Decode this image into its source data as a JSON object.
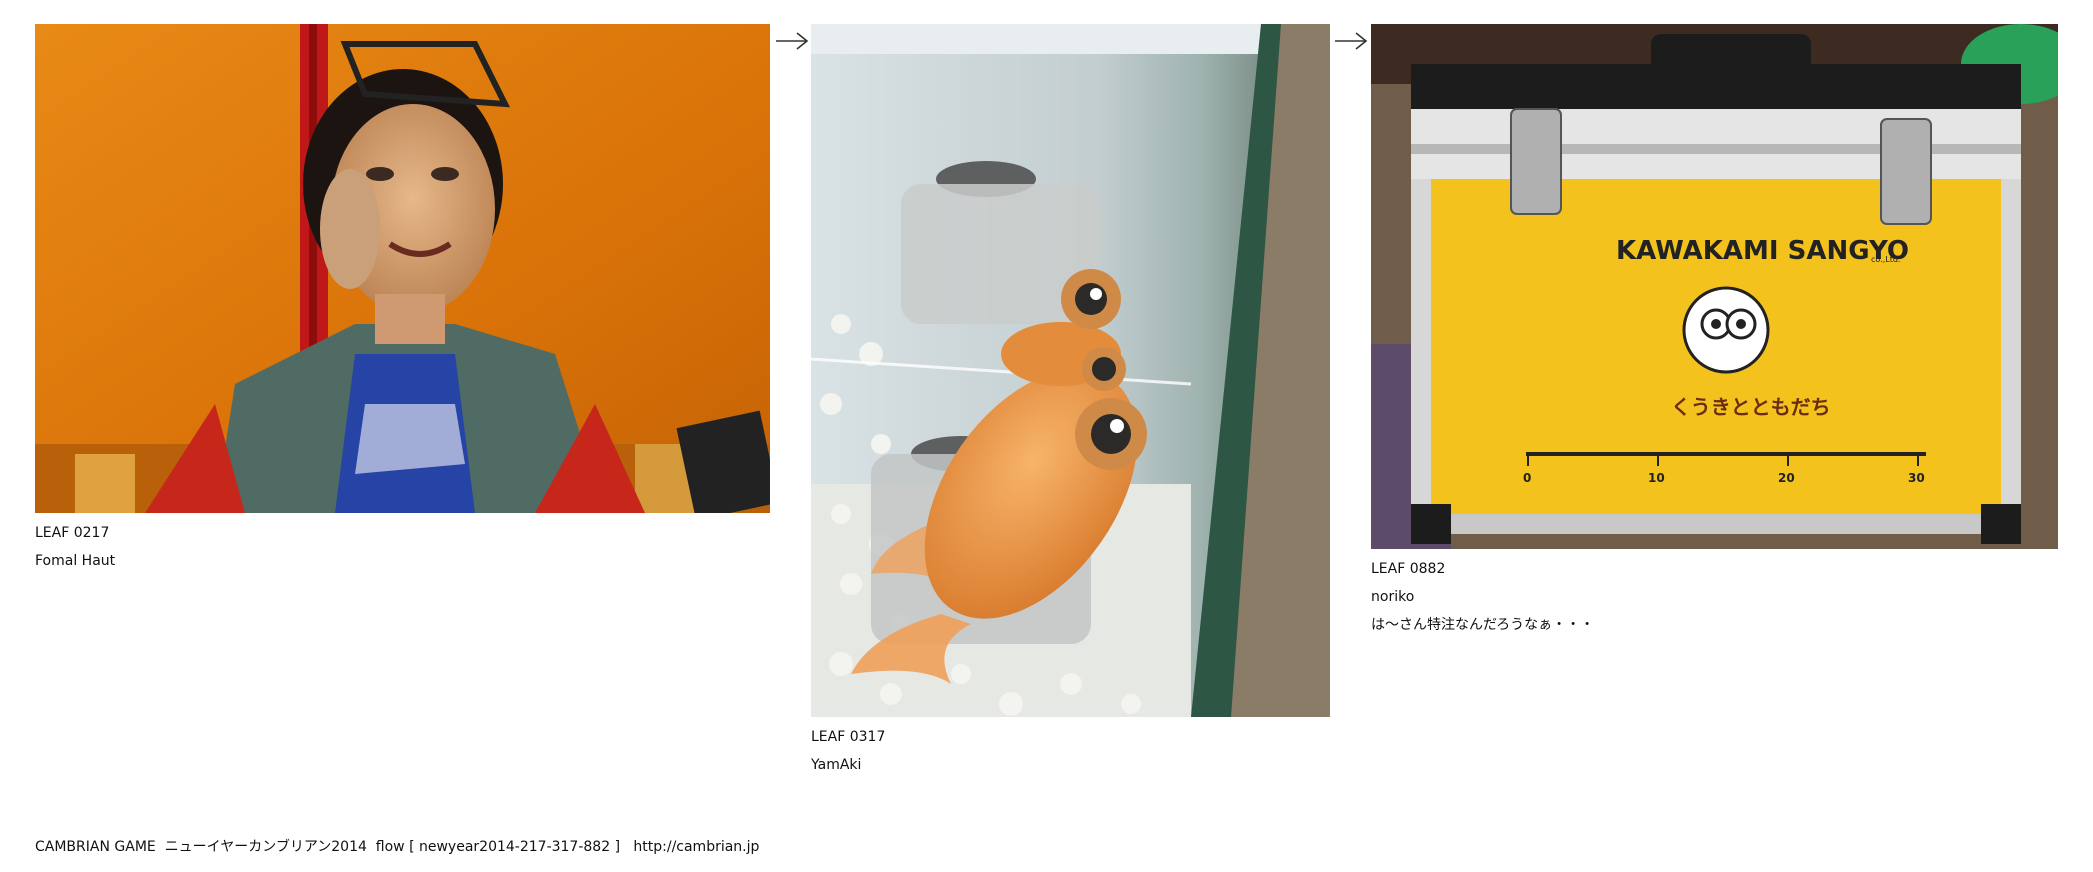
{
  "leaves": [
    {
      "image_alt": "portrait photo",
      "number": "LEAF 0217",
      "author": "Fomal Haut",
      "comment": ""
    },
    {
      "image_alt": "goldfish in aquarium",
      "number": "LEAF 0317",
      "author": "YamAki",
      "comment": ""
    },
    {
      "image_alt": "yellow aluminium case",
      "number": "LEAF 0882",
      "author": "noriko",
      "comment": "は～さん特注なんだろうなぁ・・・"
    }
  ],
  "case_print": {
    "brand": "KAWAKAMI SANGYO",
    "brand_suffix": "co.,Ltd.",
    "product": "くうきとともだち",
    "ruler_ticks": [
      "0",
      "10",
      "20",
      "30"
    ]
  },
  "footer": {
    "game": "CAMBRIAN GAME",
    "event": "ニューイヤーカンブリアン2014",
    "flow": "flow [ newyear2014-217-317-882 ]",
    "url": "http://cambrian.jp"
  },
  "colors": {
    "arrow": "#333333",
    "case_yellow": "#f3c21d",
    "wall_orange": "#d9790f"
  },
  "icons": [
    "right-arrow-icon"
  ]
}
